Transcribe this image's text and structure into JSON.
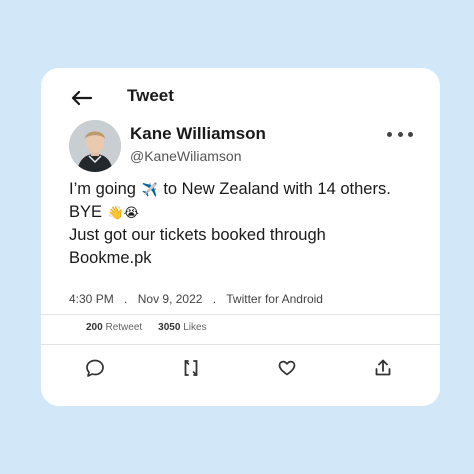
{
  "header": {
    "title": "Tweet",
    "back_icon": "arrow-left-icon"
  },
  "author": {
    "name": "Kane Williamson",
    "handle": "@KaneWiliamson"
  },
  "tweet": {
    "line1_a": "I’m going",
    "line1_emoji": "✈️",
    "line1_b": "to New Zealand with 14 others.",
    "line2_a": "BYE",
    "line2_emojis": "👋😭",
    "line3": "Just got our tickets booked through",
    "line4": "Bookme.pk"
  },
  "meta": {
    "time": "4:30 PM",
    "date": "Nov 9, 2022",
    "source": "Twitter for Android",
    "separator": "."
  },
  "stats": {
    "retweets_count": "200",
    "retweets_label": "Retweet",
    "likes_count": "3050",
    "likes_label": "Likes"
  },
  "actions": [
    "reply-icon",
    "retweet-icon",
    "like-icon",
    "share-icon"
  ],
  "colors": {
    "background": "#d2e8f9",
    "card": "#ffffff",
    "text": "#1a1a1a"
  }
}
